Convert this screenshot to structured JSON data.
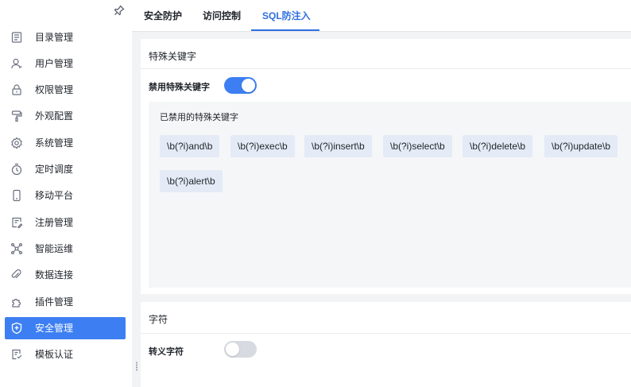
{
  "sidebar": {
    "items": [
      {
        "label": "目录管理",
        "icon": "catalog-icon"
      },
      {
        "label": "用户管理",
        "icon": "user-icon"
      },
      {
        "label": "权限管理",
        "icon": "lock-icon"
      },
      {
        "label": "外观配置",
        "icon": "paint-roller-icon"
      },
      {
        "label": "系统管理",
        "icon": "gear-icon"
      },
      {
        "label": "定时调度",
        "icon": "timer-icon"
      },
      {
        "label": "移动平台",
        "icon": "mobile-icon"
      },
      {
        "label": "注册管理",
        "icon": "registration-icon"
      },
      {
        "label": "智能运维",
        "icon": "network-nodes-icon"
      },
      {
        "label": "数据连接",
        "icon": "link-icon"
      },
      {
        "label": "插件管理",
        "icon": "puzzle-icon"
      },
      {
        "label": "安全管理",
        "icon": "shield-icon",
        "active": true
      },
      {
        "label": "模板认证",
        "icon": "template-cert-icon"
      }
    ],
    "accent": "#3d7ff2"
  },
  "tabs": [
    {
      "label": "安全防护"
    },
    {
      "label": "访问控制"
    },
    {
      "label": "SQL防注入",
      "active": true
    }
  ],
  "special_keywords": {
    "section_title": "特殊关键字",
    "toggle_label": "禁用特殊关键字",
    "toggle_on": true,
    "list_label": "已禁用的特殊关键字",
    "keywords": [
      "\\b(?i)and\\b",
      "\\b(?i)exec\\b",
      "\\b(?i)insert\\b",
      "\\b(?i)select\\b",
      "\\b(?i)delete\\b",
      "\\b(?i)update\\b",
      "\\b(?i)alert\\b"
    ]
  },
  "characters": {
    "section_title": "字符",
    "toggle_label": "转义字符",
    "toggle_on": false
  }
}
